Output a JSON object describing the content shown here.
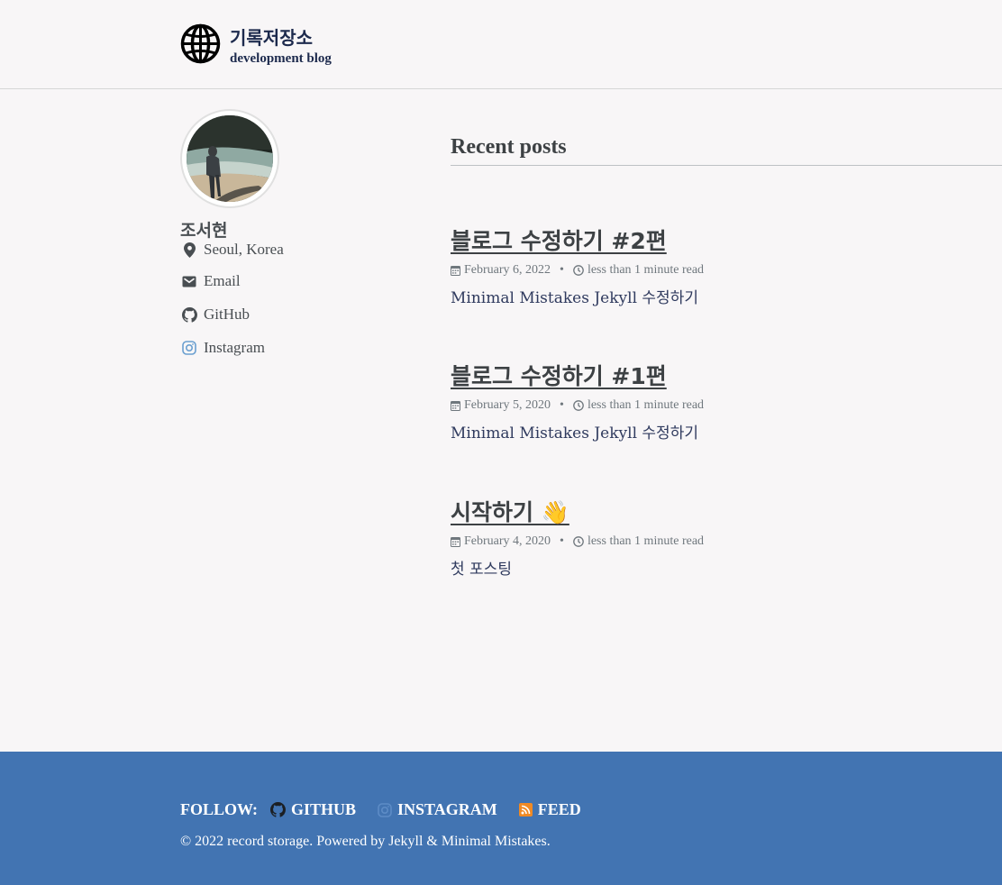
{
  "header": {
    "site_title": "기록저장소",
    "site_subtitle": "development blog",
    "logo_icon": "globe-icon"
  },
  "author": {
    "name": "조서현",
    "location": "Seoul, Korea",
    "links": [
      {
        "label": "Email",
        "icon": "envelope-icon"
      },
      {
        "label": "GitHub",
        "icon": "github-icon"
      },
      {
        "label": "Instagram",
        "icon": "instagram-icon"
      }
    ]
  },
  "main": {
    "section_title": "Recent posts",
    "posts": [
      {
        "title": "블로그 수정하기 #2편",
        "date": "February 6, 2022",
        "read_time": "less than 1 minute read",
        "excerpt": "Minimal Mistakes Jekyll 수정하기"
      },
      {
        "title": "블로그 수정하기 #1편",
        "date": "February 5, 2020",
        "read_time": "less than 1 minute read",
        "excerpt": "Minimal Mistakes Jekyll 수정하기"
      },
      {
        "title": "시작하기 👋",
        "date": "February 4, 2020",
        "read_time": "less than 1 minute read",
        "excerpt": "첫 포스팅"
      }
    ]
  },
  "footer": {
    "follow_label": "FOLLOW:",
    "links": [
      {
        "label": "GITHUB",
        "icon": "github-icon"
      },
      {
        "label": "INSTAGRAM",
        "icon": "instagram-icon"
      },
      {
        "label": "FEED",
        "icon": "rss-icon"
      }
    ],
    "copyright": "© 2022 record storage. Powered by Jekyll & Minimal Mistakes."
  },
  "colors": {
    "background": "#f8f6f7",
    "footer": "#4274b2",
    "title_navy": "#1d2a4d",
    "rss_orange": "#f08a24"
  }
}
